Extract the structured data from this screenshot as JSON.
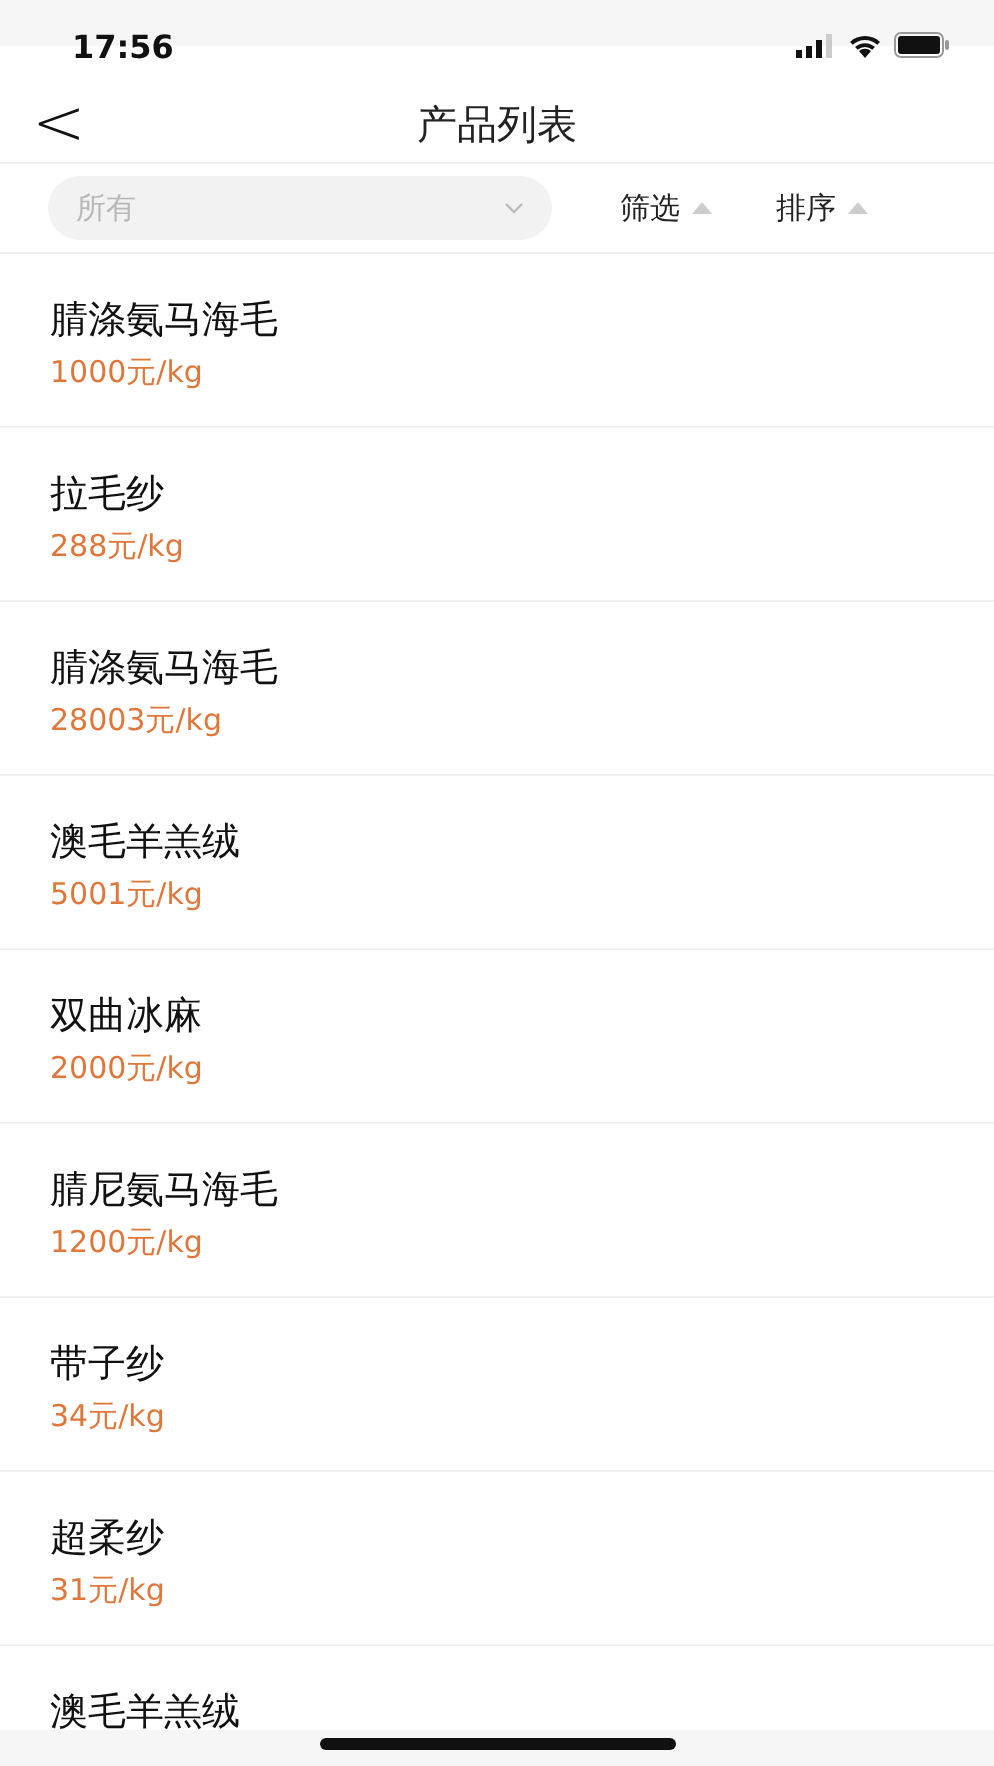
{
  "status_bar": {
    "time": "17:56"
  },
  "nav": {
    "back": "<",
    "title": "产品列表"
  },
  "filter_bar": {
    "category": {
      "placeholder": "所有"
    },
    "buttons": [
      {
        "label": "筛选"
      },
      {
        "label": "排序"
      }
    ]
  },
  "products": [
    {
      "name": "腈涤氨马海毛",
      "price": "1000元/kg"
    },
    {
      "name": "拉毛纱",
      "price": "288元/kg"
    },
    {
      "name": "腈涤氨马海毛",
      "price": "28003元/kg"
    },
    {
      "name": "澳毛羊羔绒",
      "price": "5001元/kg"
    },
    {
      "name": "双曲冰麻",
      "price": "2000元/kg"
    },
    {
      "name": "腈尼氨马海毛",
      "price": "1200元/kg"
    },
    {
      "name": "带子纱",
      "price": "34元/kg"
    },
    {
      "name": "超柔纱",
      "price": "31元/kg"
    },
    {
      "name": "澳毛羊羔绒"
    }
  ]
}
